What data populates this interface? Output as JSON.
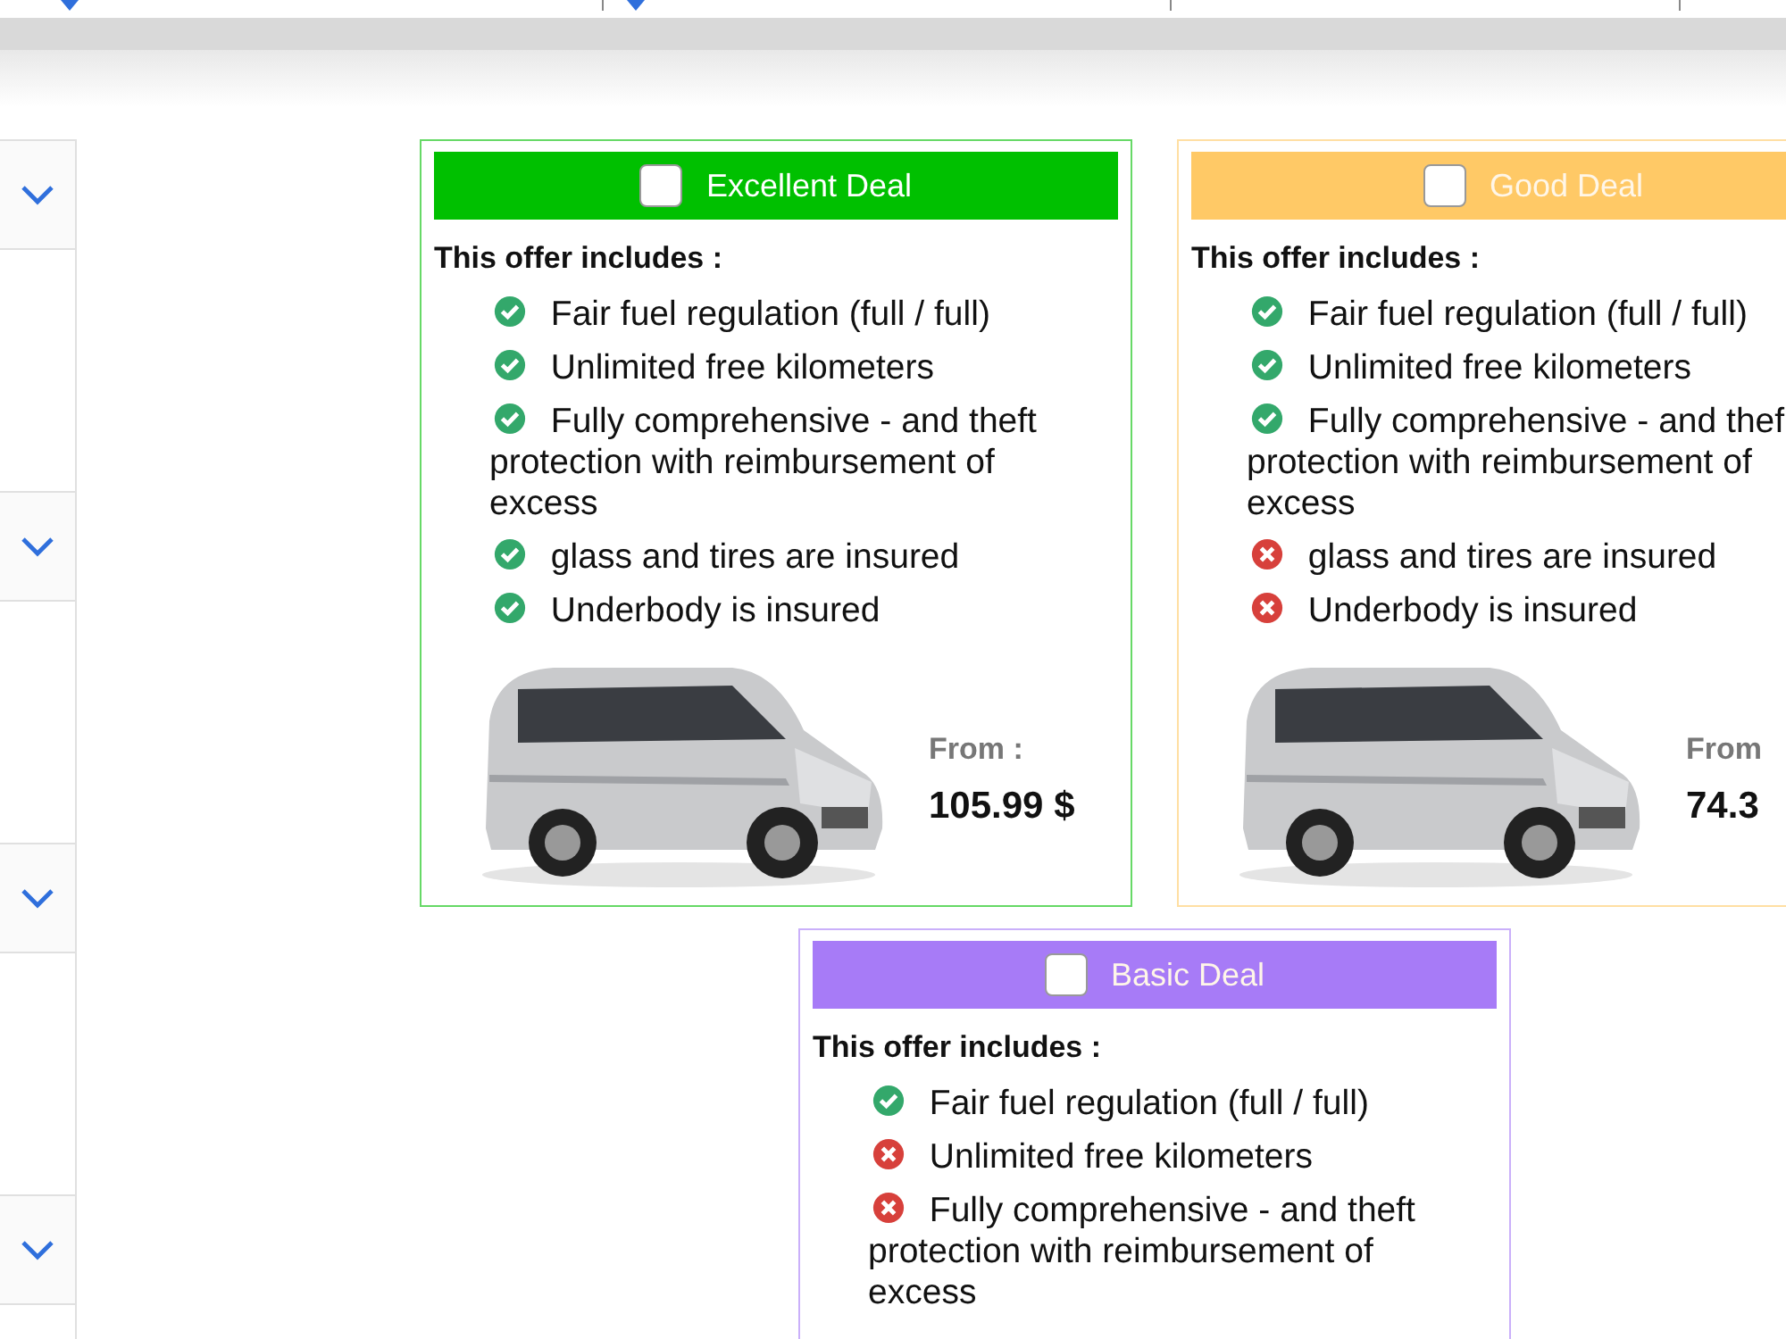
{
  "side_toggles": [
    {
      "expanded": false
    },
    {
      "expanded": false
    },
    {
      "expanded": false
    },
    {
      "expanded": false
    }
  ],
  "deals": [
    {
      "title": "Excellent Deal",
      "color": "#00c000",
      "checked": false,
      "heading": "This offer includes :",
      "features": [
        {
          "text": "Fair fuel regulation (full / full)",
          "included": true
        },
        {
          "text": "Unlimited free kilometers",
          "included": true
        },
        {
          "text": "Fully comprehensive - and theft protection with reimbursement of excess",
          "included": true
        },
        {
          "text": "glass and tires are insured",
          "included": true
        },
        {
          "text": "Underbody is insured",
          "included": true
        }
      ],
      "price_label": "From :",
      "price": "105.99 $"
    },
    {
      "title": "Good Deal",
      "color": "#ffc966",
      "checked": false,
      "heading": "This offer includes :",
      "features": [
        {
          "text": "Fair fuel regulation (full / full)",
          "included": true
        },
        {
          "text": "Unlimited free kilometers",
          "included": true
        },
        {
          "text": "Fully comprehensive - and thef protection with reimbursement of excess",
          "included": true
        },
        {
          "text": "glass and tires are insured",
          "included": false
        },
        {
          "text": "Underbody is insured",
          "included": false
        }
      ],
      "price_label": "From",
      "price": "74.3"
    },
    {
      "title": "Basic Deal",
      "color": "#a77bf7",
      "checked": false,
      "heading": "This offer includes :",
      "features": [
        {
          "text": "Fair fuel regulation (full / full)",
          "included": true
        },
        {
          "text": "Unlimited free kilometers",
          "included": false
        },
        {
          "text": "Fully comprehensive - and theft protection with reimbursement of excess",
          "included": false
        }
      ]
    }
  ]
}
